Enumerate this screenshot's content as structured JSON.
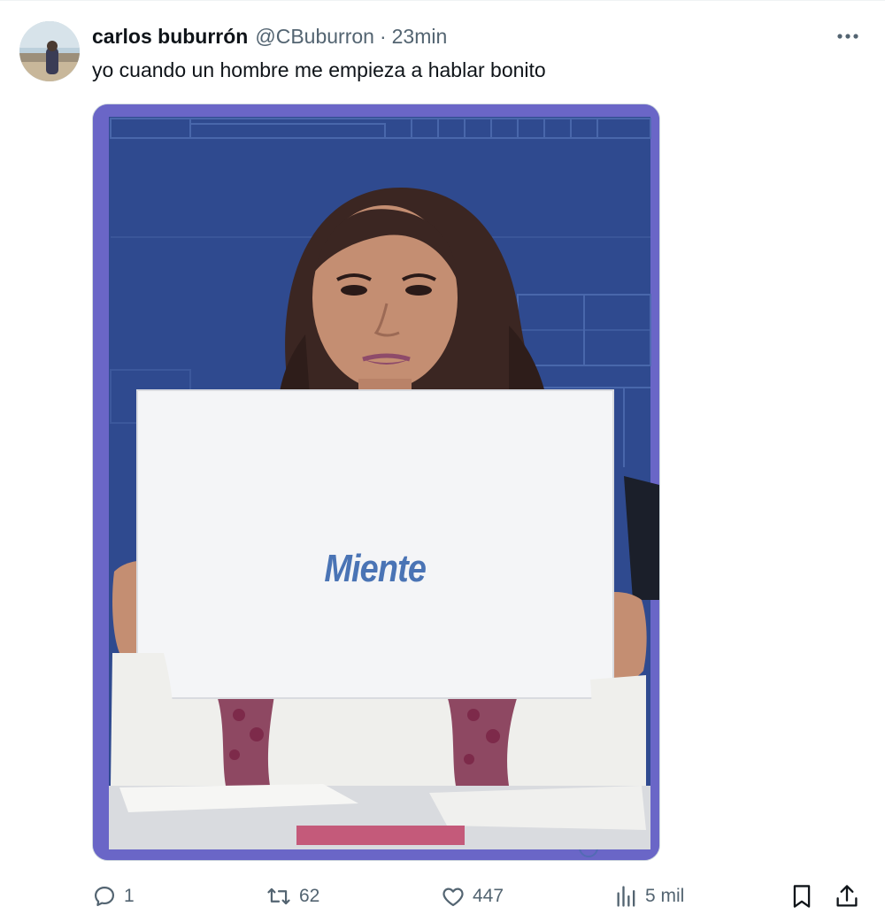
{
  "tweet": {
    "author_name": "carlos buburrón",
    "handle": "@CBuburron",
    "separator": "·",
    "time": "23min",
    "text": "yo cuando un hombre me empieza a hablar bonito",
    "media": {
      "sign_text": "Miente"
    }
  },
  "actions": {
    "replies": "1",
    "reposts": "62",
    "likes": "447",
    "views": "5 mil"
  },
  "icons": {
    "more": "more-icon",
    "reply": "reply-icon",
    "repost": "repost-icon",
    "like": "heart-icon",
    "views": "views-icon",
    "bookmark": "bookmark-icon",
    "share": "share-icon"
  },
  "colors": {
    "text_primary": "#0f1419",
    "text_secondary": "#536471",
    "media_frame": "#6a66c7",
    "studio_blue": "#2f4a8f",
    "sign_text": "#4a74b5"
  }
}
